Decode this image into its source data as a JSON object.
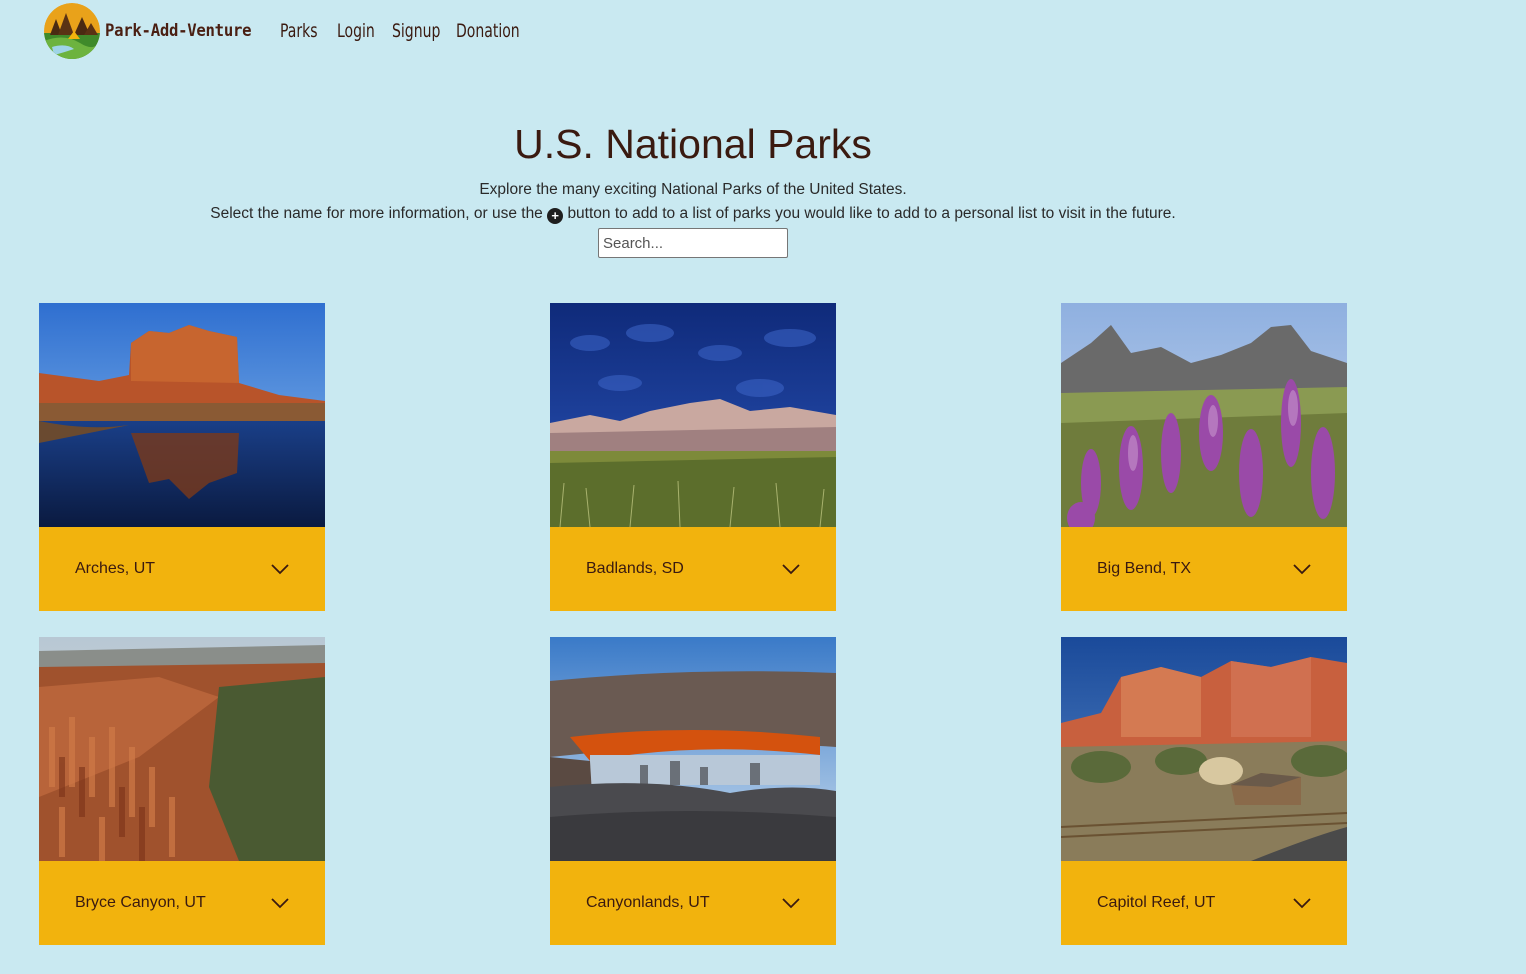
{
  "nav": {
    "brand": "Park-Add-Venture",
    "links": [
      "Parks",
      "Login",
      "Signup",
      "Donation"
    ]
  },
  "hero": {
    "title": "U.S. National Parks",
    "line1": "Explore the many exciting National Parks of the United States.",
    "line2_before": "Select the name for more information, or use the",
    "line2_after": "button to add to a list of parks you would like to add to a personal list to visit in the future.",
    "search_placeholder": "Search..."
  },
  "parks": [
    {
      "name": "Arches, UT",
      "scene": "arches"
    },
    {
      "name": "Badlands, SD",
      "scene": "badlands"
    },
    {
      "name": "Big Bend, TX",
      "scene": "bigbend"
    },
    {
      "name": "Bryce Canyon, UT",
      "scene": "bryce"
    },
    {
      "name": "Canyonlands, UT",
      "scene": "canyonlands"
    },
    {
      "name": "Capitol Reef, UT",
      "scene": "capitolreef"
    }
  ],
  "colors": {
    "background": "#c9e9f1",
    "card_bar": "#f2b30d",
    "text": "#3a1a10"
  }
}
